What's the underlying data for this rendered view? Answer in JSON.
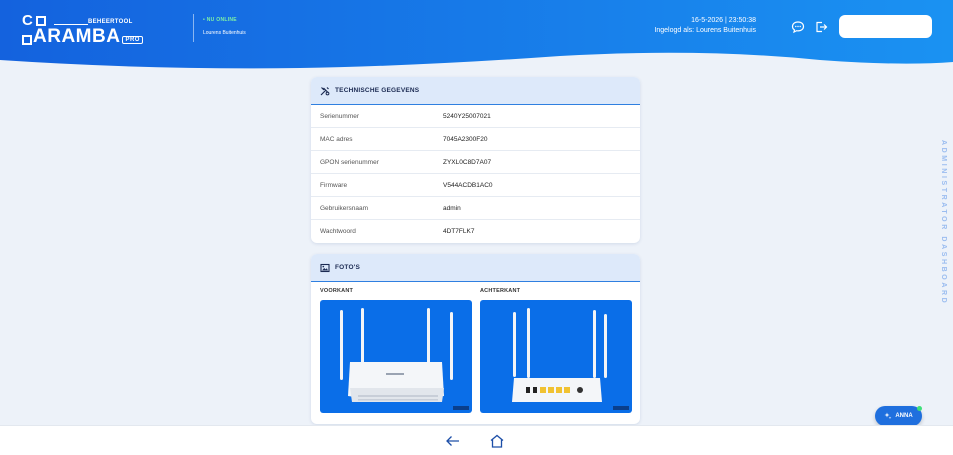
{
  "header": {
    "logo_top": "C",
    "logo_sub": "BEHEERTOOL",
    "logo_main": "ARAMBA",
    "logo_pro": "PRO",
    "status": "• NU ONLINE",
    "status_user": "Lourens Buitenhuis",
    "datetime": "16-5-2026 | 23:50:38",
    "logged_in": "Ingelogd als: Lourens Buitenhuis",
    "chat_icon": "chat-bubble-icon",
    "logout_icon": "logout-icon"
  },
  "side_label": "ADMINISTRATOR DASHBOARD",
  "tech": {
    "title": "TECHNISCHE GEGEVENS",
    "icon": "tools-icon",
    "rows": [
      {
        "k": "Serienummer",
        "v": "5240Y25007021"
      },
      {
        "k": "MAC adres",
        "v": "7045A2300F20"
      },
      {
        "k": "GPON serienummer",
        "v": "ZYXL0C8D7A07"
      },
      {
        "k": "Firmware",
        "v": "V544ACDB1AC0"
      },
      {
        "k": "Gebruikersnaam",
        "v": "admin"
      },
      {
        "k": "Wachtwoord",
        "v": "4DT7FLK7"
      }
    ]
  },
  "photos": {
    "title": "FOTO'S",
    "icon": "image-icon",
    "front_label": "VOORKANT",
    "back_label": "ACHTERKANT"
  },
  "bottom": {
    "back_icon": "arrow-left-icon",
    "home_icon": "home-icon"
  },
  "anna": {
    "label": "ANNA",
    "icon": "sparkle-icon"
  },
  "colors": {
    "header_left": "#1466e0",
    "header_right": "#1a8ff0",
    "accent": "#2f7fe0",
    "card_head": "#dde9fa"
  }
}
